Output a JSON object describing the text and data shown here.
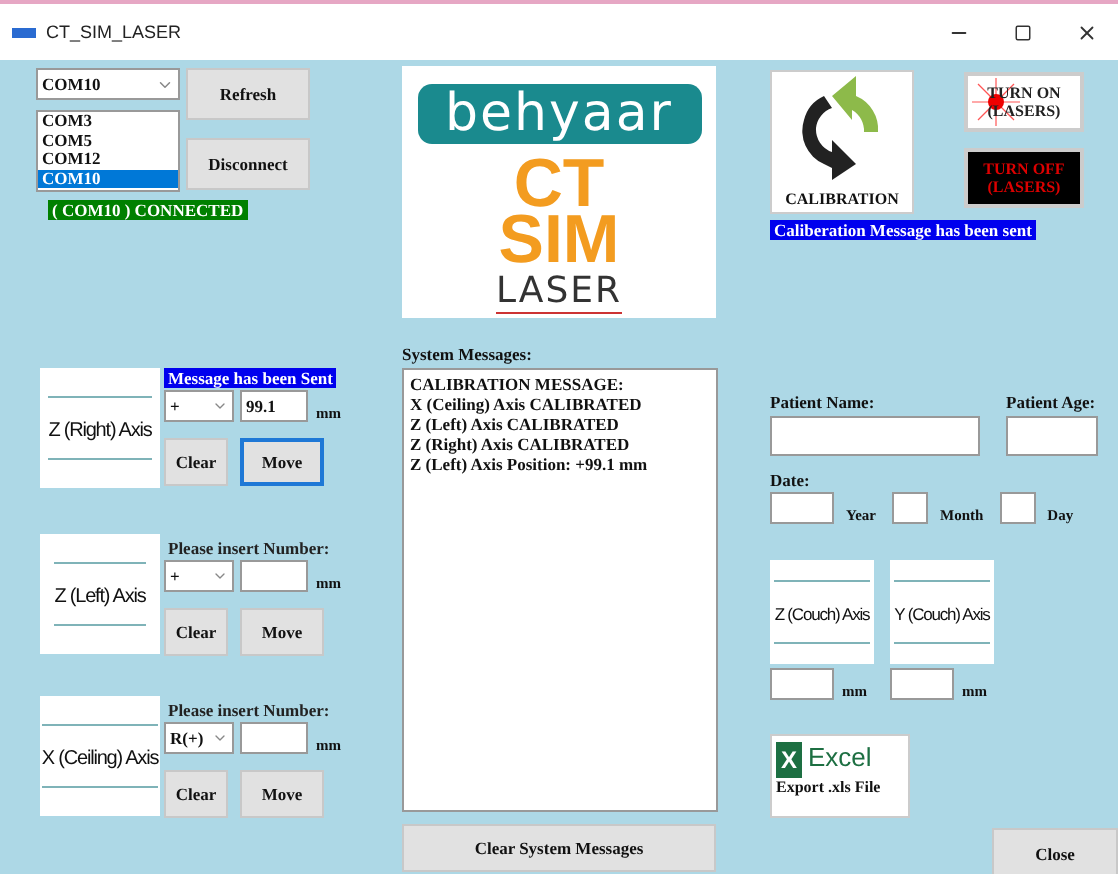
{
  "window": {
    "title": "CT_SIM_LASER"
  },
  "connection": {
    "port_select": {
      "value": "COM10"
    },
    "ports": [
      {
        "label": "COM3",
        "selected": false
      },
      {
        "label": "COM5",
        "selected": false
      },
      {
        "label": "COM12",
        "selected": false
      },
      {
        "label": "COM10",
        "selected": true
      }
    ],
    "refresh_button": "Refresh",
    "disconnect_button": "Disconnect",
    "status": "( COM10 ) CONNECTED"
  },
  "axes": [
    {
      "image_label": "Z (Right) Axis",
      "prompt": "Message has been Sent",
      "prompt_highlighted": true,
      "direction": "+",
      "value": "99.1",
      "unit": "mm",
      "clear_button": "Clear",
      "move_button": "Move",
      "move_focused": true
    },
    {
      "image_label": "Z (Left) Axis",
      "prompt": "Please insert Number:",
      "prompt_highlighted": false,
      "direction": "+",
      "unit": "mm",
      "clear_button": "Clear",
      "move_button": "Move",
      "move_focused": false
    },
    {
      "image_label": "X (Ceiling) Axis",
      "prompt": "Please insert Number:",
      "prompt_highlighted": false,
      "direction": "R(+)",
      "unit": "mm",
      "clear_button": "Clear",
      "move_button": "Move",
      "move_focused": false
    }
  ],
  "logo": {
    "brand": "behyaar",
    "line_1": "CT",
    "line_2": "SIM",
    "line_3": "LASER"
  },
  "system_messages": {
    "label": "System Messages:",
    "lines": [
      "CALIBRATION MESSAGE:",
      "X (Ceiling) Axis CALIBRATED",
      "Z (Left) Axis CALIBRATED",
      "Z (Right) Axis CALIBRATED",
      "Z (Left) Axis Position: +99.1 mm"
    ],
    "clear_button": "Clear System Messages"
  },
  "calibration": {
    "label": "CALIBRATION",
    "message": "Caliberation Message has been sent"
  },
  "lasers": [
    {
      "kind": "on",
      "label": "TURN ON (LASERS)"
    },
    {
      "kind": "off",
      "label": "TURN OFF (LASERS)"
    }
  ],
  "patient": {
    "name_label": "Patient Name:",
    "age_label": "Patient Age:",
    "date_label": "Date:",
    "date_units": [
      "Year",
      "Month",
      "Day"
    ]
  },
  "couch_axes": [
    {
      "image_label": "Z (Couch) Axis",
      "unit": "mm"
    },
    {
      "image_label": "Y (Couch) Axis",
      "unit": "mm"
    }
  ],
  "export": {
    "icon_letter": "X",
    "brand": "Excel",
    "label": "Export .xls File"
  },
  "close_button": "Close"
}
